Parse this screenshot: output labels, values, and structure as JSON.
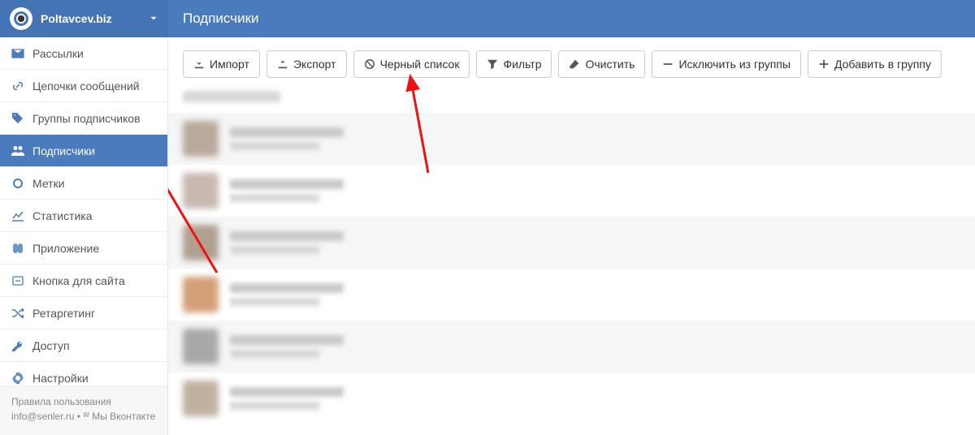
{
  "brand": {
    "name": "Poltavcev.biz"
  },
  "page": {
    "title": "Подписчики"
  },
  "sidebar": {
    "items": [
      {
        "icon": "envelope-icon",
        "label": "Рассылки",
        "active": false
      },
      {
        "icon": "link-icon",
        "label": "Цепочки сообщений",
        "active": false
      },
      {
        "icon": "tags-icon",
        "label": "Группы подписчиков",
        "active": false
      },
      {
        "icon": "users-icon",
        "label": "Подписчики",
        "active": true
      },
      {
        "icon": "circle-icon",
        "label": "Метки",
        "active": false
      },
      {
        "icon": "chart-line-icon",
        "label": "Статистика",
        "active": false
      },
      {
        "icon": "app-icon",
        "label": "Приложение",
        "active": false
      },
      {
        "icon": "widget-icon",
        "label": "Кнопка для сайта",
        "active": false
      },
      {
        "icon": "shuffle-icon",
        "label": "Ретаргетинг",
        "active": false
      },
      {
        "icon": "key-icon",
        "label": "Доступ",
        "active": false
      },
      {
        "icon": "cog-icon",
        "label": "Настройки",
        "active": false
      }
    ]
  },
  "footer": {
    "line1": "Правила пользования",
    "line2": "info@senler.ru • ᵂ Мы Вконтакте"
  },
  "toolbar": {
    "buttons": [
      {
        "icon": "download-icon",
        "label": "Импорт"
      },
      {
        "icon": "upload-icon",
        "label": "Экспорт"
      },
      {
        "icon": "ban-icon",
        "label": "Черный список"
      },
      {
        "icon": "filter-icon",
        "label": "Фильтр"
      },
      {
        "icon": "eraser-icon",
        "label": "Очистить"
      },
      {
        "icon": "minus-icon",
        "label": "Исключить из группы"
      },
      {
        "icon": "plus-icon",
        "label": "Добавить в группу"
      }
    ]
  },
  "subscribers": {
    "rows": [
      {
        "avatar_color": "#b8a99a"
      },
      {
        "avatar_color": "#c8b8b0"
      },
      {
        "avatar_color": "#b0a090"
      },
      {
        "avatar_color": "#d4a078"
      },
      {
        "avatar_color": "#a8a8a8"
      },
      {
        "avatar_color": "#c0b0a0"
      }
    ]
  },
  "annotations": {
    "arrows": [
      {
        "to": "sidebar-item-subscribers"
      },
      {
        "to": "toolbar-blacklist-button"
      }
    ]
  }
}
